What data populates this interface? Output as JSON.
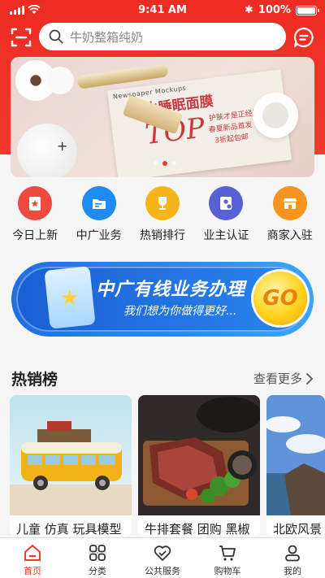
{
  "status_bar": {
    "time": "9:41 AM",
    "battery": "100%"
  },
  "search": {
    "placeholder": "牛奶整箱纯奶"
  },
  "quick_nav": [
    {
      "label": "今日上新",
      "icon": "new-today-icon",
      "color": "#ee4a3d"
    },
    {
      "label": "中广业务",
      "icon": "folder-icon",
      "color": "#1e8bf0"
    },
    {
      "label": "热销排行",
      "icon": "trophy-icon",
      "color": "#f7b51b"
    },
    {
      "label": "业主认证",
      "icon": "id-card-icon",
      "color": "#5860d6"
    },
    {
      "label": "商家入驻",
      "icon": "store-icon",
      "color": "#f7941d"
    }
  ],
  "banner": {
    "newspaper_header": "Newspaper Mockups",
    "headline": "补水睡眠面膜",
    "big_text": "TOP",
    "line1": "护肤才是正经事",
    "line2": "春夏新品首发",
    "line3": "3折起包邮"
  },
  "promo": {
    "title": "中广有线业务办理",
    "subtitle": "我们想为你做得更好...",
    "go_label": "GO"
  },
  "section": {
    "title": "热销榜",
    "more_label": "查看更多"
  },
  "products": [
    {
      "name": "儿童 仿真 玩具模型"
    },
    {
      "name": "牛排套餐 团购 黑椒"
    },
    {
      "name": "北欧风景"
    }
  ],
  "tabs": [
    {
      "label": "首页",
      "icon": "home-icon",
      "active": true
    },
    {
      "label": "分类",
      "icon": "grid-icon",
      "active": false
    },
    {
      "label": "公共服务",
      "icon": "heart-check-icon",
      "active": false
    },
    {
      "label": "购物车",
      "icon": "cart-icon",
      "active": false
    },
    {
      "label": "我的",
      "icon": "person-icon",
      "active": false
    }
  ],
  "colors": {
    "brand": "#ee3a2d",
    "promo_blue": "#1f6fe0"
  }
}
